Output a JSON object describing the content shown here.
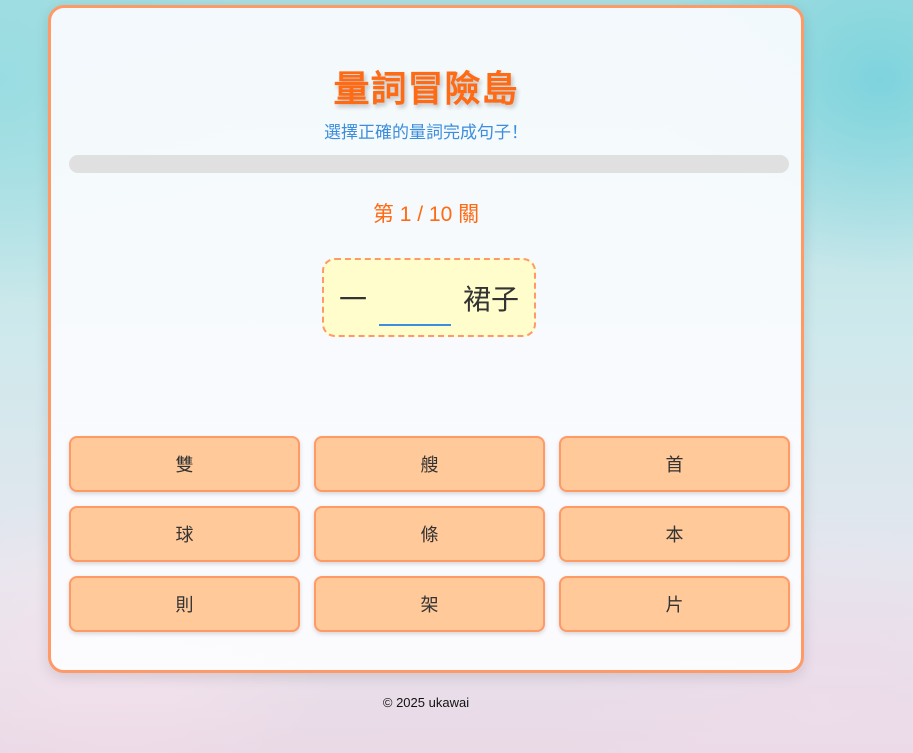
{
  "header": {
    "title": "量詞冒險島",
    "subtitle": "選擇正確的量詞完成句子！"
  },
  "progress": {
    "fraction": 0.0
  },
  "level": {
    "label": "第 1 / 10 關"
  },
  "question": {
    "before": "一",
    "after": "裙子"
  },
  "options": [
    "雙",
    "艘",
    "首",
    "球",
    "條",
    "本",
    "則",
    "架",
    "片"
  ],
  "footer": {
    "copyright": "© 2025 ukawai"
  },
  "colors": {
    "accent": "#ff6a14",
    "subtitle": "#3c8edc",
    "option_bg": "#ffc99a",
    "border": "#ff9a66"
  }
}
